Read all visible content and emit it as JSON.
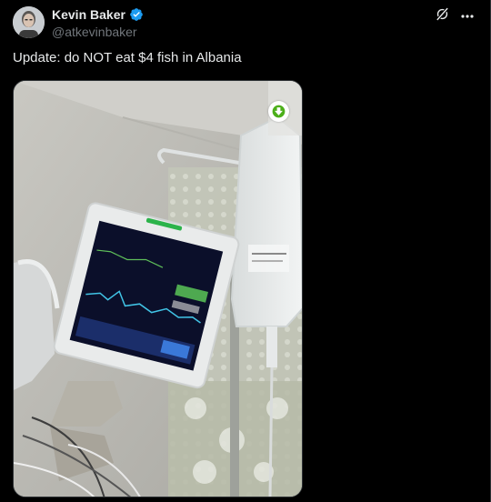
{
  "author": {
    "display_name": "Kevin Baker",
    "handle": "@atkevinbaker",
    "verified": true,
    "avatar_icon": "avatar-photo"
  },
  "tweet": {
    "text": "Update: do NOT eat $4 fish in Albania"
  },
  "actions": {
    "grok_icon": "grok-icon",
    "more_icon": "more-icon"
  },
  "media": {
    "type": "photo",
    "download_icon": "download-arrow-icon"
  },
  "colors": {
    "background": "#000000",
    "text_primary": "#e7e9ea",
    "text_secondary": "#71767b",
    "verified_blue": "#1d9bf0",
    "border": "#2f3336",
    "download_green": "#4caf1a"
  }
}
